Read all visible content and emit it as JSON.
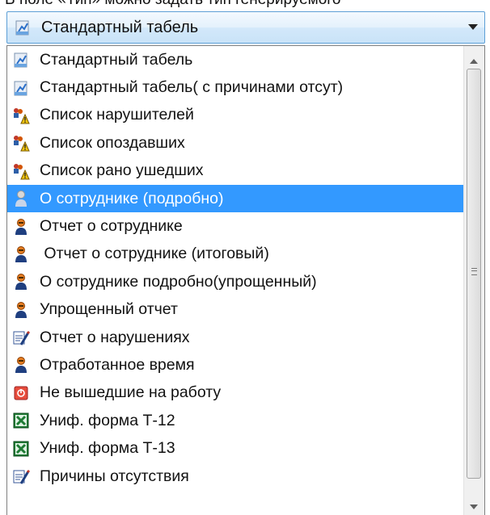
{
  "top_text": "В поле «Тип» можно задать тип генерируемого",
  "combo": {
    "selected_label": "Стандартный табель",
    "selected_icon": "report-chart-icon"
  },
  "list": {
    "items": [
      {
        "label": "Стандартный табель",
        "icon": "report-chart-icon"
      },
      {
        "label": "Стандартный табель( с причинами отсут)",
        "icon": "report-chart-icon"
      },
      {
        "label": "Список нарушителей",
        "icon": "users-warning-icon"
      },
      {
        "label": "Список опоздавших",
        "icon": "users-warning-icon"
      },
      {
        "label": "Список рано ушедших",
        "icon": "users-warning-icon"
      },
      {
        "label": "О сотруднике (подробно)",
        "icon": "employee-icon",
        "selected": true
      },
      {
        "label": "Отчет о сотруднике",
        "icon": "employee-icon"
      },
      {
        "label": " Отчет о сотруднике (итоговый)",
        "icon": "employee-icon"
      },
      {
        "label": "О сотруднике подробно(упрощенный)",
        "icon": "employee-icon"
      },
      {
        "label": "Упрощенный отчет",
        "icon": "employee-icon"
      },
      {
        "label": "Отчет о нарушениях",
        "icon": "violation-report-icon"
      },
      {
        "label": "Отработанное время",
        "icon": "employee-icon"
      },
      {
        "label": "Не вышедшие на работу",
        "icon": "absent-icon"
      },
      {
        "label": "Униф. форма Т-12",
        "icon": "excel-icon"
      },
      {
        "label": "Униф. форма Т-13",
        "icon": "excel-icon"
      },
      {
        "label": "Причины отсутствия",
        "icon": "violation-report-icon"
      }
    ]
  },
  "colors": {
    "selection": "#3399ff",
    "combo_border": "#5d9fd6"
  }
}
